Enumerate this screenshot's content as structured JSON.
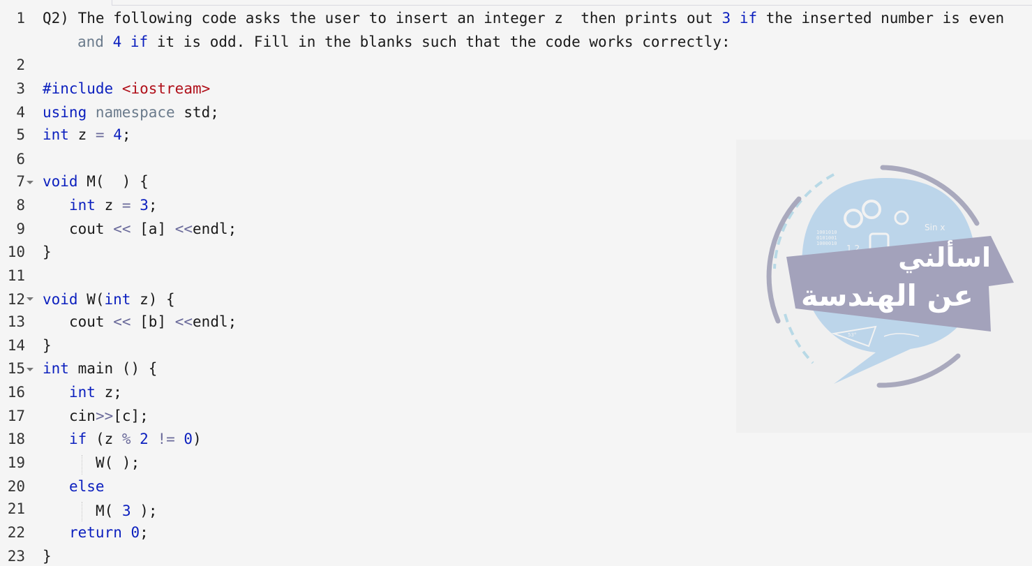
{
  "editor": {
    "line_numbers": [
      "1",
      "2",
      "3",
      "4",
      "5",
      "6",
      "7",
      "8",
      "9",
      "10",
      "11",
      "12",
      "13",
      "14",
      "15",
      "16",
      "17",
      "18",
      "19",
      "20",
      "21",
      "22",
      "23"
    ],
    "question": {
      "l1_a": "Q2) The following code asks the user to insert an integer z  then prints out ",
      "l1_n": "3",
      "l1_kw": "if",
      "l1_b": " the inserted number is even",
      "l2_kw1": "and",
      "l2_n": "4",
      "l2_kw2": "if",
      "l2_b": " it is odd. Fill in the blanks such that the code works correctly:"
    },
    "code": {
      "include_kw": "#include",
      "include_lib": "<iostream>",
      "using_kw": "using",
      "namespace_kw": "namespace",
      "std": " std;",
      "int_kw": "int",
      "z_decl": " z ",
      "eq": "=",
      "four": "4",
      "semi": ";",
      "void_kw": "void",
      "m_sig": " M(  ) {",
      "z3": " z ",
      "three": "3",
      "cout": "cout ",
      "shl": "<<",
      "blank_a": " [a] ",
      "endl": "endl;",
      "close": "}",
      "w_sig_a": " W(",
      "w_sig_b": " z) {",
      "blank_b": " [b] ",
      "main_sig": " main () {",
      "z_semi": " z;",
      "cin": "cin",
      "shr": ">>",
      "blank_c": "[c];",
      "if_kw": "if",
      "cond_a": " (z ",
      "mod": "%",
      "two": " 2 ",
      "neq": "!=",
      "zero": " 0",
      "paren": ")",
      "w_call": "W( );",
      "else_kw": "else",
      "m_call_a": "M( ",
      "m_call_n": "3",
      "m_call_b": " );",
      "return_kw": "return",
      "ret_zero": " 0",
      "ret_semi": ";"
    }
  },
  "watermark": {
    "title_line1": "اسألني",
    "title_line2": "عن الهندسة",
    "binary": "1001010\n0101001\n1000010",
    "sinx": "Sin x",
    "small_num": "1 2",
    "angle": "53°"
  },
  "colors": {
    "keyword": "#0b1fbe",
    "string": "#b0101a",
    "operator": "#6a6a9a",
    "namespace": "#6b7b8c",
    "background": "#f5f5f5"
  }
}
